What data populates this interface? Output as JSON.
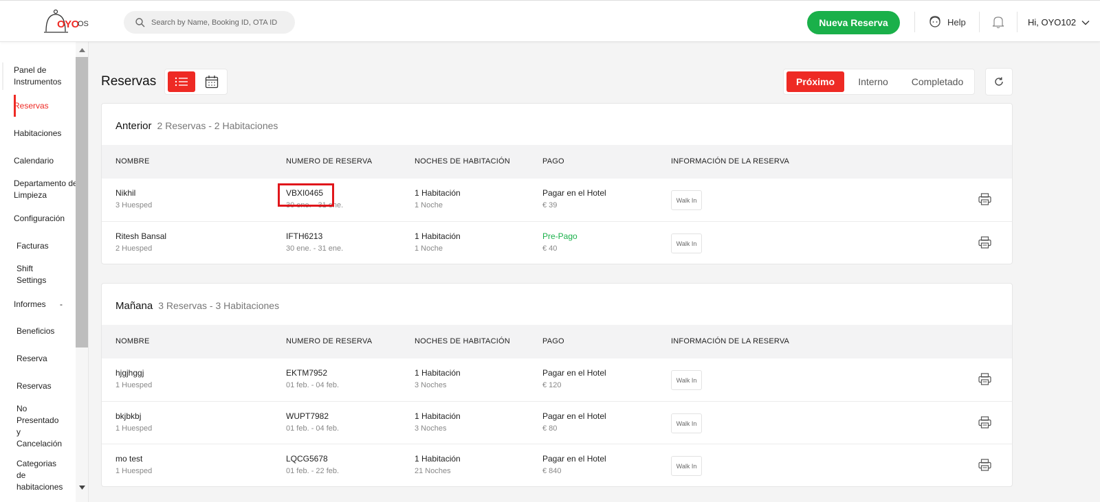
{
  "header": {
    "logo_text": "OYO",
    "logo_suffix": "OS",
    "search_placeholder": "Search by Name, Booking ID, OTA ID",
    "new_booking": "Nueva Reserva",
    "help": "Help",
    "user_greeting": "Hi, OYO102"
  },
  "sidebar": {
    "items": [
      {
        "label": "Panel de Instrumentos"
      },
      {
        "label": "Reservas"
      },
      {
        "label": "Habitaciones"
      },
      {
        "label": "Calendario"
      },
      {
        "label": "Departamento de Limpieza"
      },
      {
        "label": "Configuración"
      },
      {
        "label": "Facturas"
      },
      {
        "label": "Shift Settings"
      },
      {
        "label": "Informes"
      },
      {
        "label": "Beneficios"
      },
      {
        "label": "Reserva"
      },
      {
        "label": "Reservas"
      },
      {
        "label": "No Presentado y Cancelación"
      },
      {
        "label": "Categorias de habitaciones"
      }
    ],
    "collapse_marker": "-"
  },
  "main": {
    "title": "Reservas",
    "tabs": [
      {
        "label": "Próximo"
      },
      {
        "label": "Interno"
      },
      {
        "label": "Completado"
      }
    ],
    "columns": [
      "NOMBRE",
      "NUMERO DE RESERVA",
      "NOCHES DE HABITACIÓN",
      "PAGO",
      "INFORMACIÓN DE LA RESERVA"
    ],
    "sections": [
      {
        "title": "Anterior",
        "summary": "2 Reservas - 2 Habitaciones",
        "rows": [
          {
            "name": "Nikhil",
            "guests": "3 Huesped",
            "booking_id": "VBXI0465",
            "dates": "30 ene. - 31 ene.",
            "rooms": "1 Habitación",
            "nights": "1 Noche",
            "payment": "Pagar en el Hotel",
            "amount": "€ 39",
            "info": "Walk In"
          },
          {
            "name": "Ritesh Bansal",
            "guests": "2 Huesped",
            "booking_id": "IFTH6213",
            "dates": "30 ene. - 31 ene.",
            "rooms": "1 Habitación",
            "nights": "1 Noche",
            "payment": "Pre-Pago",
            "amount": "€ 40",
            "info": "Walk In"
          }
        ]
      },
      {
        "title": "Mañana",
        "summary": "3 Reservas - 3 Habitaciones",
        "rows": [
          {
            "name": "hjgjhggj",
            "guests": "1 Huesped",
            "booking_id": "EKTM7952",
            "dates": "01 feb. - 04 feb.",
            "rooms": "1 Habitación",
            "nights": "3 Noches",
            "payment": "Pagar en el Hotel",
            "amount": "€ 120",
            "info": "Walk In"
          },
          {
            "name": "bkjbkbj",
            "guests": "1 Huesped",
            "booking_id": "WUPT7982",
            "dates": "01 feb. - 04 feb.",
            "rooms": "1 Habitación",
            "nights": "3 Noches",
            "payment": "Pagar en el Hotel",
            "amount": "€ 80",
            "info": "Walk In"
          },
          {
            "name": "mo test",
            "guests": "1 Huesped",
            "booking_id": "LQCG5678",
            "dates": "01 feb. - 22 feb.",
            "rooms": "1 Habitación",
            "nights": "21 Noches",
            "payment": "Pagar en el Hotel",
            "amount": "€ 840",
            "info": "Walk In"
          }
        ]
      }
    ]
  },
  "colors": {
    "brand_red": "#ee2a24",
    "success_green": "#1ab04a",
    "highlight_red": "#e0161b"
  }
}
